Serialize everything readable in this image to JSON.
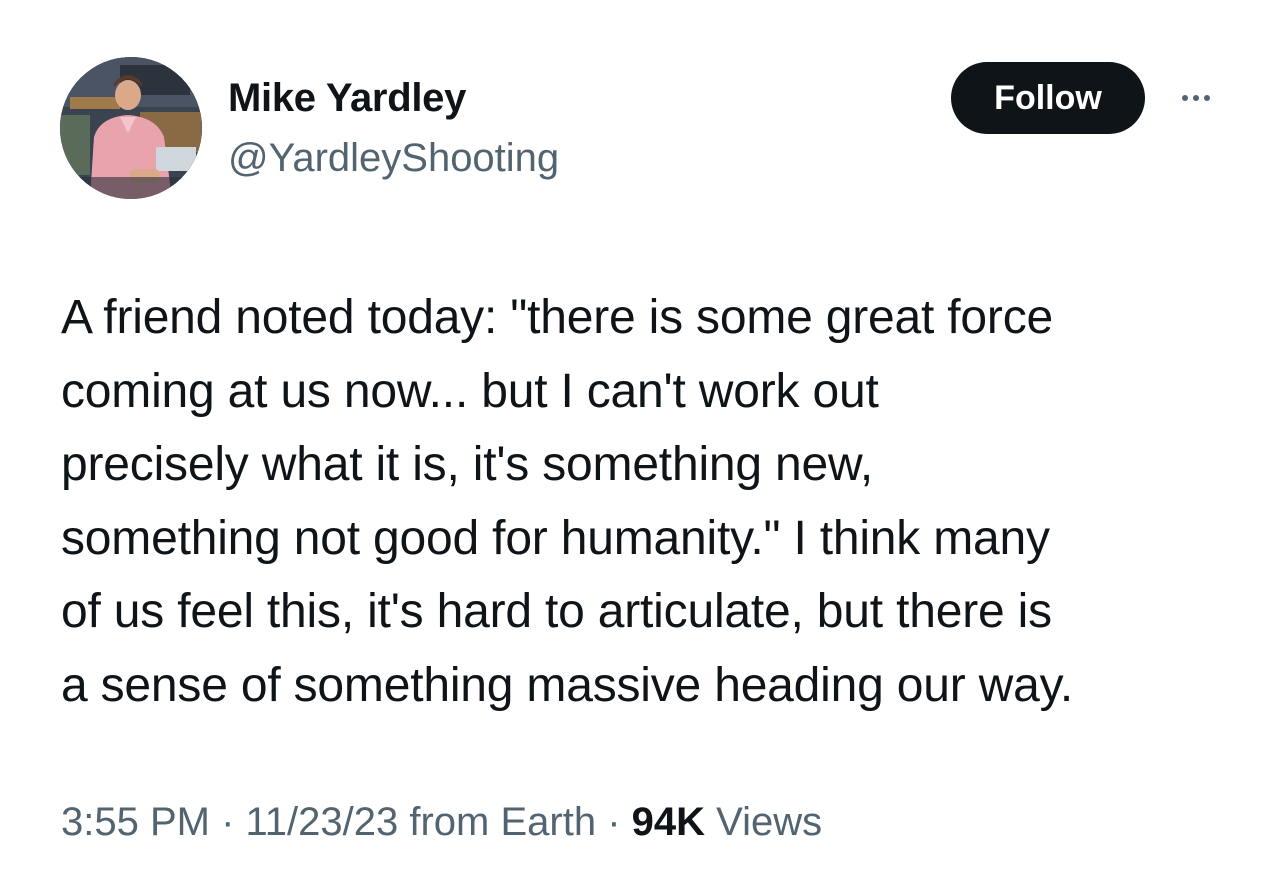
{
  "author": {
    "name": "Mike Yardley",
    "handle": "@YardleyShooting",
    "avatar_icon": "avatar-photo"
  },
  "actions": {
    "follow_label": "Follow",
    "more_icon": "more-options-icon"
  },
  "tweet": {
    "lines": [
      "A friend noted today: \"there is some great force",
      "coming at us now... but I can't work out",
      "precisely what it is, it's something new,",
      "something not good for humanity.\" I think many",
      "of us feel this, it's hard to articulate, but there is",
      "a sense of something massive heading our way."
    ]
  },
  "meta": {
    "time": "3:55 PM",
    "separator": " · ",
    "date": "11/23/23",
    "source": " from Earth",
    "views_count": "94K",
    "views_label": " Views"
  },
  "colors": {
    "text_primary": "#0f1419",
    "text_secondary": "#536471",
    "button_bg": "#0f1419",
    "button_text": "#ffffff",
    "background": "#ffffff"
  }
}
